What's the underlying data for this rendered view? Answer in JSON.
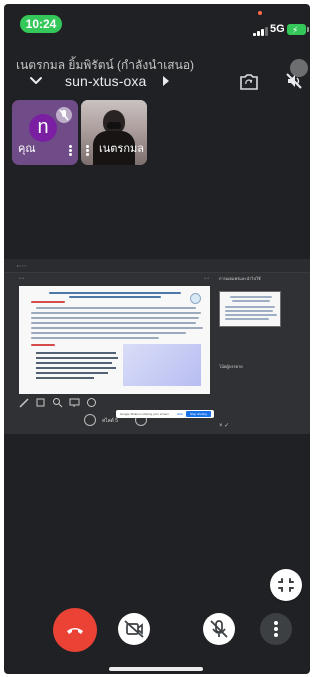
{
  "status_bar": {
    "time": "10:24",
    "network": "5G",
    "battery_state": "charging",
    "colors": {
      "time_pill": "#34c759",
      "battery": "#34c759",
      "indicator": "#ff6a4d"
    }
  },
  "header": {
    "presenter_text": "เนตรกมล ยิ้มพิรัตน์ (กำลังนำเสนอ)",
    "meeting_code": "sun-xtus-oxa",
    "icons": [
      "chevron-down-icon",
      "caret-right-icon",
      "camera-switch-icon",
      "speaker-off-icon"
    ]
  },
  "participants": [
    {
      "name": "คุณ",
      "avatar_letter": "n",
      "muted": true,
      "avatar_color": "#7b1fa2"
    },
    {
      "name": "เนตรกมล",
      "muted": false
    }
  ],
  "presentation": {
    "slide_counter": "สไลด์ 5",
    "side_panel_title": "การเผยแพร่และนำไปใช้",
    "side_label": "โน้ตผู้บรรยาย",
    "presenting_banner": {
      "text": "Google Slides is sharing your screen",
      "stop_label": "Stop sharing",
      "hide_label": "Hide"
    }
  },
  "controls": {
    "end_call_color": "#ea4335",
    "buttons": [
      "end-call-icon",
      "camera-off-icon",
      "mic-off-icon",
      "more-vert-icon"
    ]
  }
}
